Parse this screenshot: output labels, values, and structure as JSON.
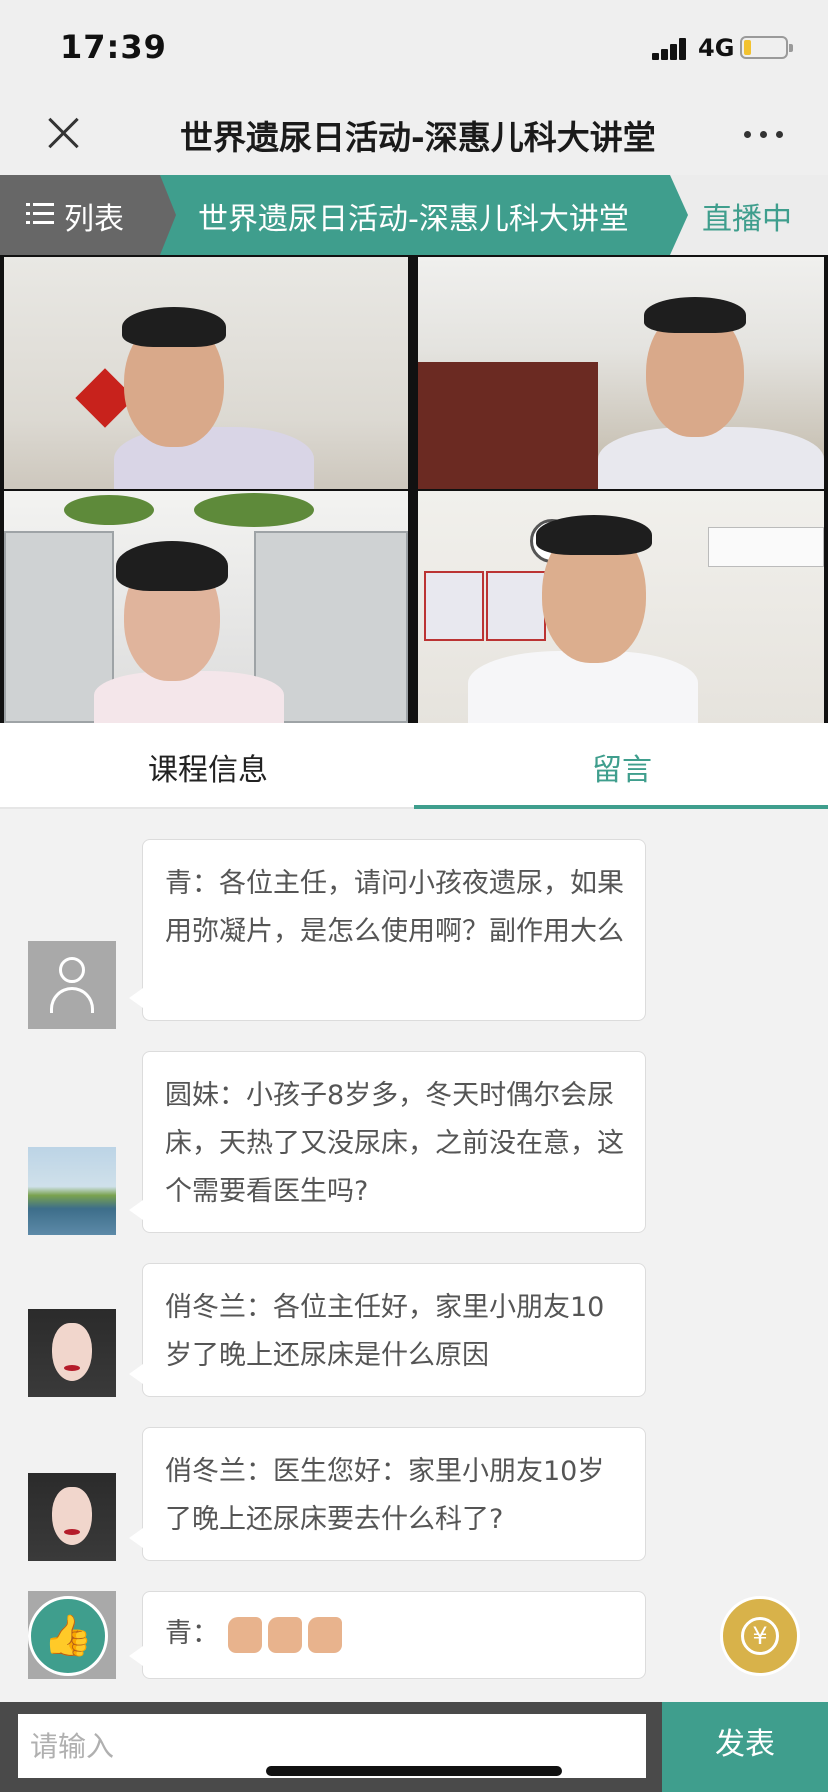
{
  "status_bar": {
    "time": "17:39",
    "network": "4G"
  },
  "nav": {
    "title": "世界遗尿日活动-深惠儿科大讲堂"
  },
  "strip": {
    "list_label": "列表",
    "course_label": "世界遗尿日活动-深惠儿科大讲堂",
    "live_label": "直播中"
  },
  "tabs": [
    {
      "label": "课程信息"
    },
    {
      "label": "留言",
      "active": true
    }
  ],
  "messages": [
    {
      "text": "青：各位主任，请问小孩夜遗尿，如果用弥凝片，是怎么使用啊？副作用大么",
      "avatar": "default-avatar"
    },
    {
      "text": "圆妹：小孩子8岁多，冬天时偶尔会尿床，天热了又没尿床，之前没在意，这个需要看医生吗?",
      "avatar": "scenery-avatar"
    },
    {
      "text": "俏冬兰：各位主任好，家里小朋友10岁了晚上还尿床是什么原因",
      "avatar": "girl-avatar"
    },
    {
      "text": "俏冬兰：医生您好：家里小朋友10岁了晚上还尿床要去什么科了?",
      "avatar": "girl-avatar"
    },
    {
      "text": "青：",
      "avatar": "default-avatar",
      "emoji": "thumbs-up x3"
    }
  ],
  "input": {
    "placeholder": "请输入",
    "value": ""
  },
  "send_label": "发表",
  "colors": {
    "accent": "#3f9e8d",
    "reward": "#d8b24a",
    "list_tab": "#676767"
  },
  "icons": {
    "close": "close-icon",
    "more": "more-icon",
    "list": "list-icon",
    "like": "thumbs-up-icon",
    "reward": "yuan-icon"
  }
}
